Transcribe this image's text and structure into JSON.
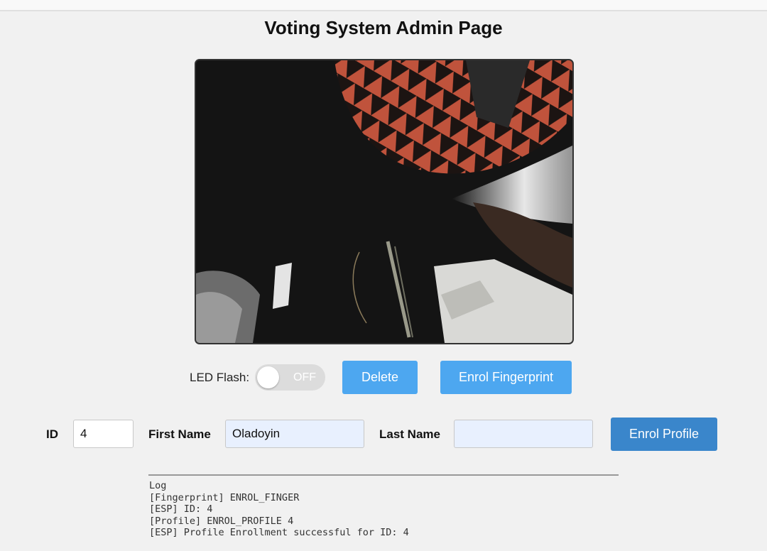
{
  "page": {
    "title": "Voting System Admin Page"
  },
  "camera": {
    "feed_description": "live camera stream"
  },
  "controls": {
    "led_label": "LED Flash:",
    "led_state": "OFF",
    "delete_label": "Delete",
    "enrol_fingerprint_label": "Enrol Fingerprint"
  },
  "profile_form": {
    "id_label": "ID",
    "id_value": "4",
    "first_name_label": "First Name",
    "first_name_value": "Oladoyin",
    "last_name_label": "Last Name",
    "last_name_value": "",
    "enrol_profile_label": "Enrol Profile"
  },
  "log": {
    "title": "Log",
    "lines": [
      "[Fingerprint] ENROL_FINGER",
      "[ESP] ID: 4",
      "[Profile] ENROL_PROFILE 4",
      "[ESP] Profile Enrollment successful for ID: 4"
    ]
  },
  "colors": {
    "background": "#f1f1f1",
    "primary_button": "#4da7f0",
    "profile_button": "#3a86cb",
    "autofill_field": "#e8f0fe"
  }
}
